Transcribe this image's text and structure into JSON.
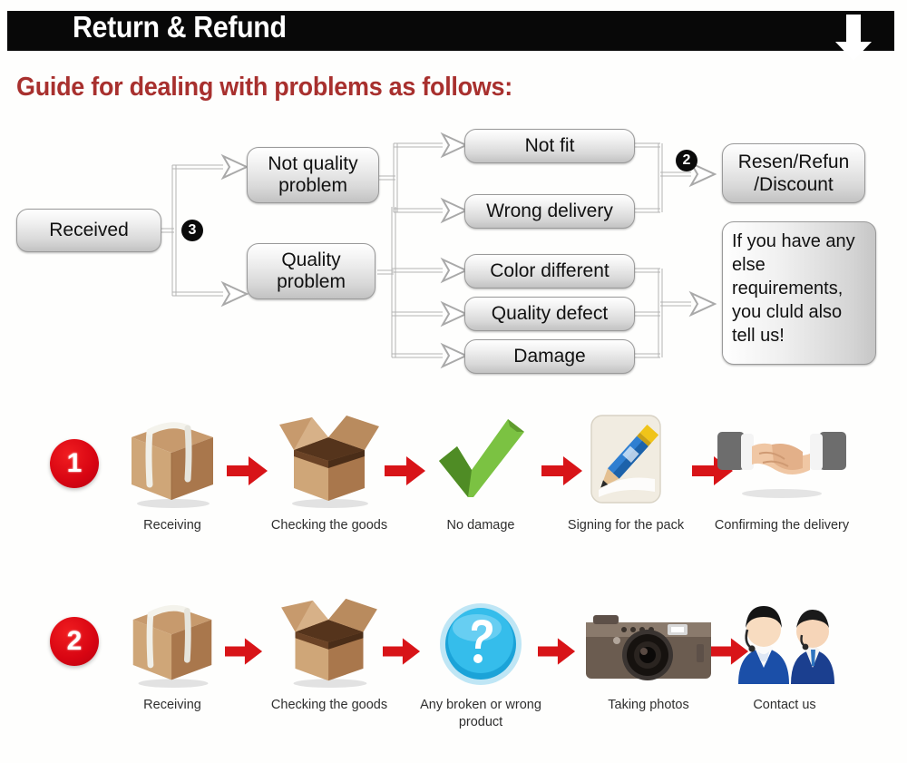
{
  "header": {
    "title": "Return & Refund",
    "arrow_icon": "down-arrow-icon",
    "bar_color": "#080808",
    "text_color": "#ffffff"
  },
  "guide": {
    "heading": "Guide for dealing with problems as follows:",
    "color": "#a8302e"
  },
  "flowchart": {
    "start": {
      "label": "Received"
    },
    "badges": {
      "start_branch": "3",
      "resolution": "2"
    },
    "categories": [
      {
        "label": "Not quality\nproblem",
        "line1": "Not quality",
        "line2": "problem"
      },
      {
        "label": "Quality\nproblem",
        "line1": "Quality",
        "line2": "problem"
      }
    ],
    "issues": [
      {
        "label": "Not fit"
      },
      {
        "label": "Wrong delivery"
      },
      {
        "label": "Color different"
      },
      {
        "label": "Quality defect"
      },
      {
        "label": "Damage"
      }
    ],
    "outcomes": [
      {
        "line1": "Resen/Refun",
        "line2": "/Discount"
      },
      {
        "text": "If you have any else requirements, you cluld also tell us!"
      }
    ]
  },
  "process": {
    "rows": [
      {
        "number": "1",
        "steps": [
          {
            "caption": "Receiving",
            "icon": "closed-box-icon"
          },
          {
            "caption": "Checking the goods",
            "icon": "open-box-icon"
          },
          {
            "caption": "No damage",
            "icon": "green-checkmark-icon"
          },
          {
            "caption": "Signing for the pack",
            "icon": "pencil-signing-icon"
          },
          {
            "caption": "Confirming the delivery",
            "icon": "handshake-icon"
          }
        ]
      },
      {
        "number": "2",
        "steps": [
          {
            "caption": "Receiving",
            "icon": "closed-box-icon"
          },
          {
            "caption": "Checking the goods",
            "icon": "open-box-icon"
          },
          {
            "caption": "Any broken or wrong product",
            "icon": "blue-question-mark-icon"
          },
          {
            "caption": "Taking photos",
            "icon": "camera-icon"
          },
          {
            "caption": "Contact us",
            "icon": "support-agents-icon"
          }
        ]
      }
    ],
    "arrow_icon": "red-right-arrow-icon",
    "arrow_color": "#d81418"
  }
}
